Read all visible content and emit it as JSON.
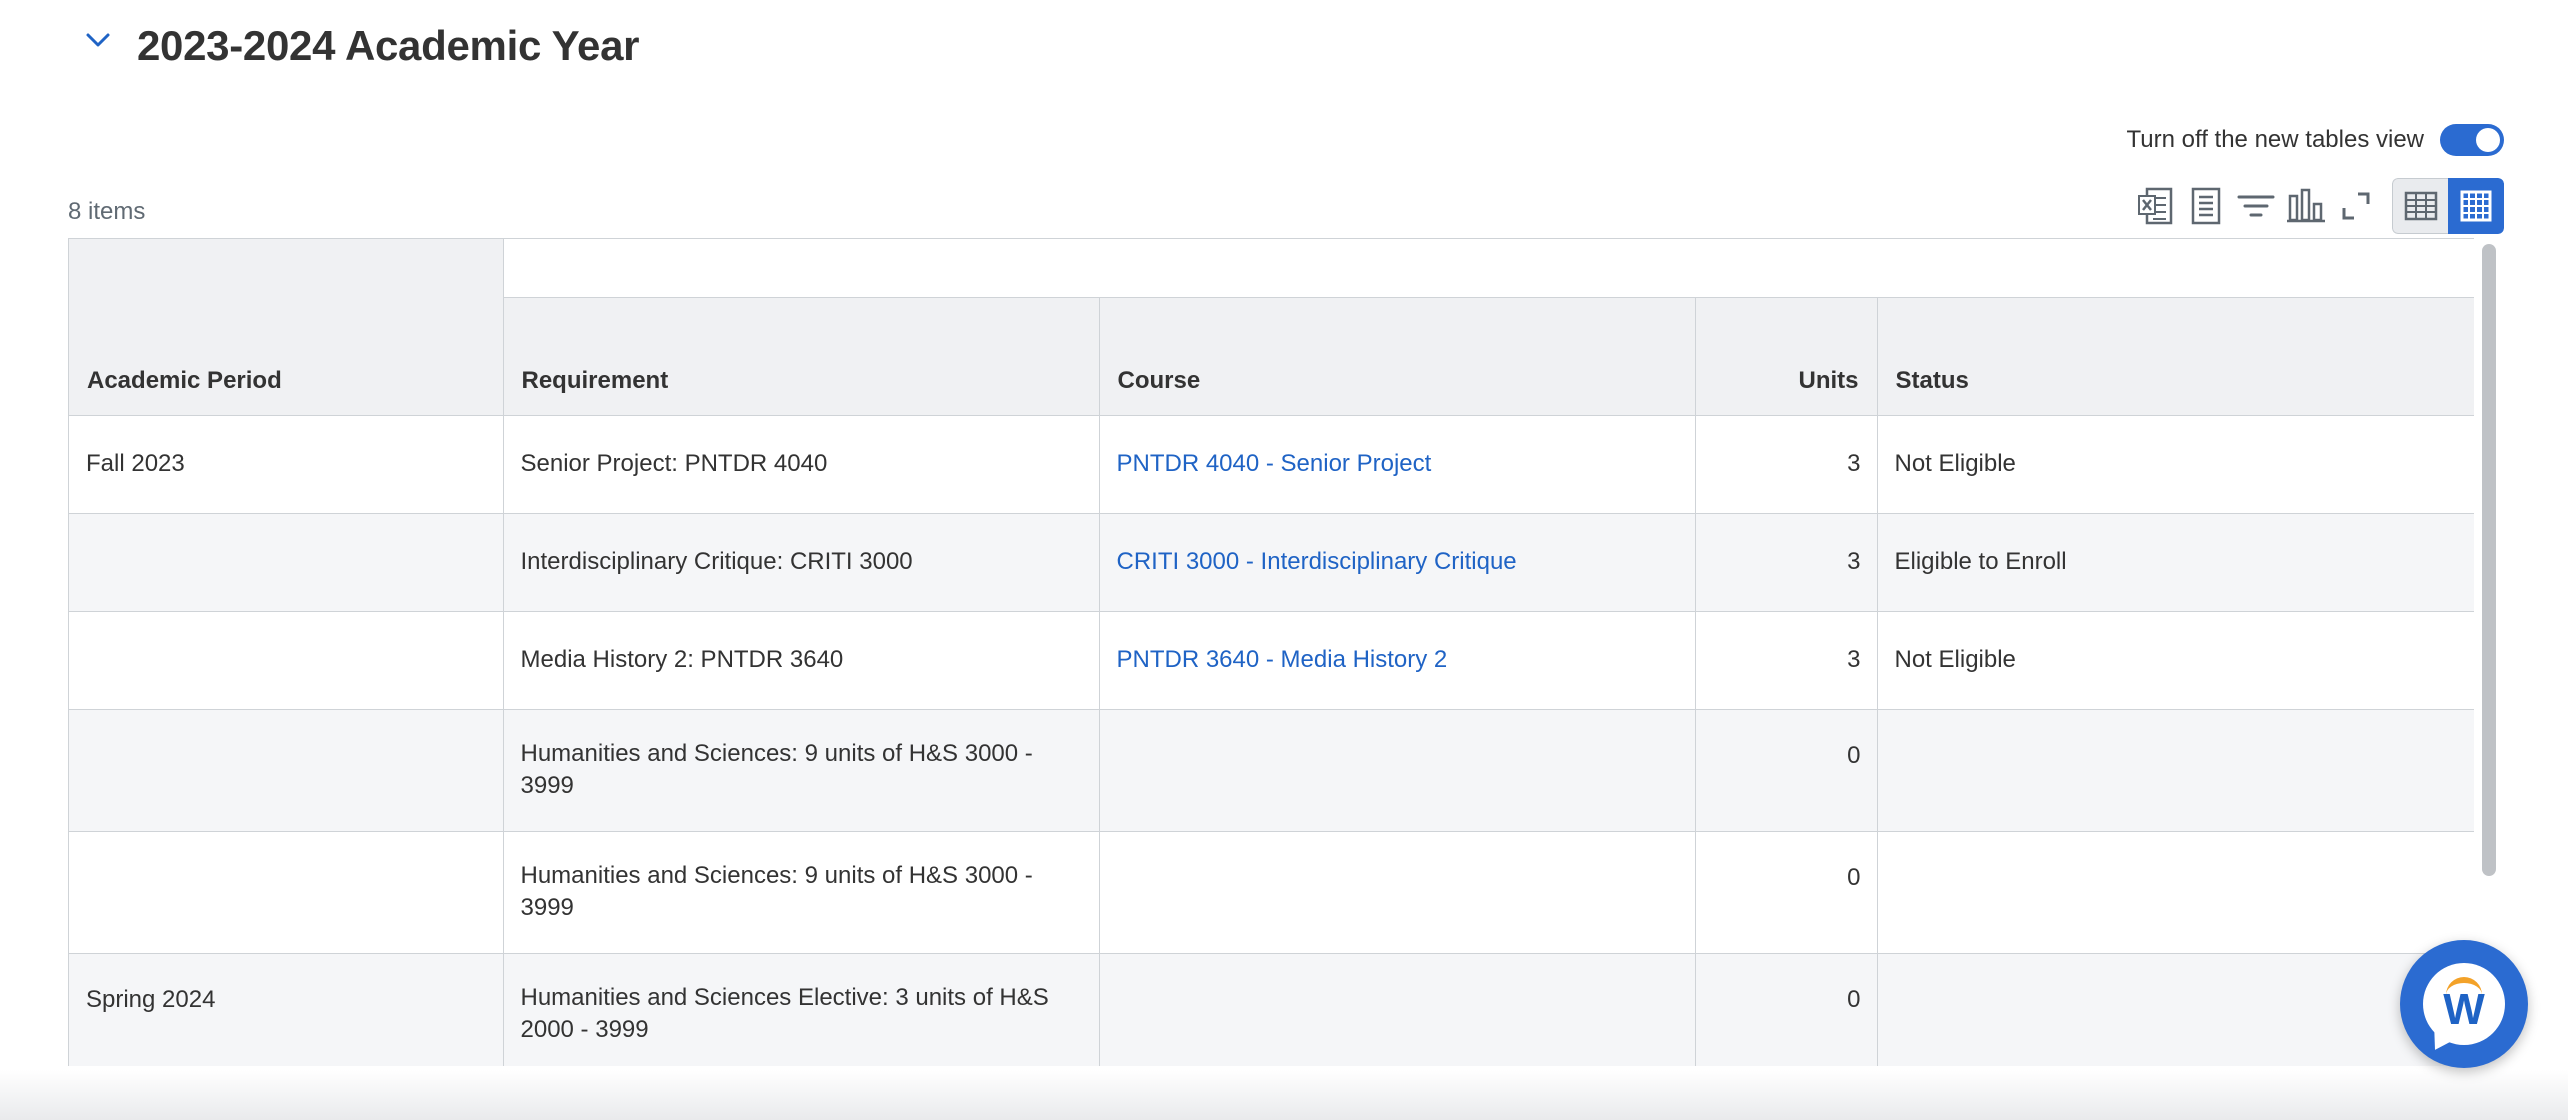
{
  "section": {
    "title": "2023-2024 Academic Year"
  },
  "toggle": {
    "label": "Turn off the new tables view",
    "on": true
  },
  "table": {
    "item_count": "8 items",
    "columns": {
      "period": "Academic Period",
      "requirement": "Requirement",
      "course": "Course",
      "units": "Units",
      "status": "Status"
    },
    "rows": [
      {
        "period": "Fall 2023",
        "requirement": "Senior Project: PNTDR 4040",
        "course": "PNTDR 4040 - Senior Project",
        "units": "3",
        "status": "Not Eligible"
      },
      {
        "period": "",
        "requirement": "Interdisciplinary Critique: CRITI 3000",
        "course": "CRITI 3000 - Interdisciplinary Critique",
        "units": "3",
        "status": "Eligible to Enroll"
      },
      {
        "period": "",
        "requirement": "Media History 2: PNTDR 3640",
        "course": "PNTDR 3640 - Media History 2",
        "units": "3",
        "status": "Not Eligible"
      },
      {
        "period": "",
        "requirement": "Humanities and Sciences: 9 units of H&S 3000 - 3999",
        "course": "",
        "units": "0",
        "status": ""
      },
      {
        "period": "",
        "requirement": "Humanities and Sciences: 9 units of H&S 3000 - 3999",
        "course": "",
        "units": "0",
        "status": ""
      },
      {
        "period": "Spring 2024",
        "requirement": "Humanities and Sciences Elective: 3 units of H&S 2000 - 3999",
        "course": "",
        "units": "0",
        "status": ""
      }
    ]
  },
  "toolbar": {
    "icons": [
      "export-excel-icon",
      "export-pdf-icon",
      "filter-icon",
      "chart-icon",
      "fullscreen-icon",
      "table-view-icon",
      "grid-view-icon"
    ]
  },
  "assistant": {
    "letter": "W"
  },
  "colors": {
    "accent": "#2b6bd1",
    "link": "#1f63c5",
    "header_bg": "#f0f1f3",
    "orange": "#f3a229"
  }
}
